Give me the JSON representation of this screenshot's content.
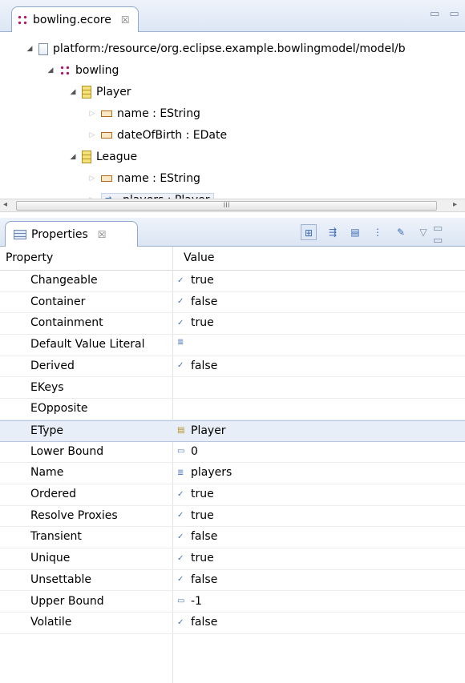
{
  "editor": {
    "tab_title": "bowling.ecore",
    "tab_close": "☒",
    "window_controls": "▭ ▭",
    "tree": [
      {
        "label": "platform:/resource/org.eclipse.example.bowlingmodel/model/b",
        "icon": "file-icon",
        "level": 0
      },
      {
        "label": "bowling",
        "icon": "package-icon",
        "level": 1
      },
      {
        "label": "Player",
        "icon": "class-icon",
        "level": 2
      },
      {
        "label": "name : EString",
        "icon": "attribute-icon",
        "level": 3
      },
      {
        "label": "dateOfBirth : EDate",
        "icon": "attribute-icon",
        "level": 3
      },
      {
        "label": "League",
        "icon": "class-icon",
        "level": 2
      },
      {
        "label": "name : EString",
        "icon": "attribute-icon",
        "level": 3
      },
      {
        "label": "players : Player",
        "icon": "reference-icon",
        "level": 3
      }
    ],
    "scroll_thumb": "III"
  },
  "properties": {
    "tab_title": "Properties",
    "tab_close": "☒",
    "columns": {
      "property": "Property",
      "value": "Value"
    },
    "rows": [
      {
        "name": "Changeable",
        "value": "true"
      },
      {
        "name": "Container",
        "value": "false"
      },
      {
        "name": "Containment",
        "value": "true"
      },
      {
        "name": "Default Value Literal",
        "value": ""
      },
      {
        "name": "Derived",
        "value": "false"
      },
      {
        "name": "EKeys",
        "value": ""
      },
      {
        "name": "EOpposite",
        "value": ""
      },
      {
        "name": "EType",
        "value": "Player"
      },
      {
        "name": "Lower Bound",
        "value": "0"
      },
      {
        "name": "Name",
        "value": "players"
      },
      {
        "name": "Ordered",
        "value": "true"
      },
      {
        "name": "Resolve Proxies",
        "value": "true"
      },
      {
        "name": "Transient",
        "value": "false"
      },
      {
        "name": "Unique",
        "value": "true"
      },
      {
        "name": "Unsettable",
        "value": "false"
      },
      {
        "name": "Upper Bound",
        "value": "-1"
      },
      {
        "name": "Volatile",
        "value": "false"
      }
    ],
    "selected_row": "EType"
  }
}
